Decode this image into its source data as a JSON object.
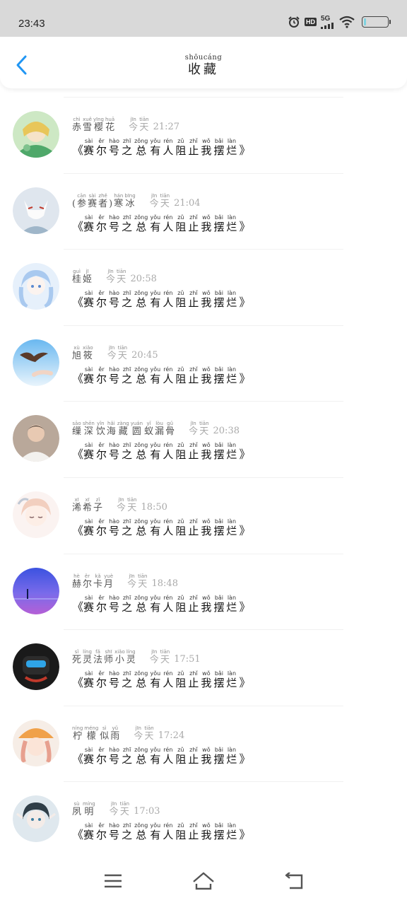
{
  "status_bar": {
    "time": "23:43",
    "icons": [
      "alarm-icon",
      "hd-icon",
      "5g-signal-icon",
      "wifi-icon",
      "battery-icon"
    ],
    "hd_label": "HD",
    "network_label": "5G",
    "battery_level": 0.1
  },
  "header": {
    "title": "收藏",
    "title_pinyin": "shōucáng",
    "back_icon": "chevron-left-icon"
  },
  "colors": {
    "accent": "#2196f3",
    "status_bar_bg": "#d9d9d9",
    "text_primary": "#222222",
    "text_muted": "#aaaaaa"
  },
  "items": [
    {
      "nickname": [
        [
          "赤",
          "chì"
        ],
        [
          "雪",
          "xuě"
        ],
        [
          "樱",
          "yīng"
        ],
        [
          "花",
          "huā"
        ]
      ],
      "day": [
        [
          "今",
          "jīn"
        ],
        [
          "天",
          "tiān"
        ]
      ],
      "time": "21:27",
      "title": [
        [
          "赛",
          "sài"
        ],
        [
          "尔",
          "ěr"
        ],
        [
          "号",
          "hào"
        ],
        [
          "之",
          "zhī"
        ],
        [
          "总",
          "zǒng"
        ],
        [
          "有",
          "yǒu"
        ],
        [
          "人",
          "rén"
        ],
        [
          "阻",
          "zǔ"
        ],
        [
          "止",
          "zhǐ"
        ],
        [
          "我",
          "wǒ"
        ],
        [
          "摆",
          "bǎi"
        ],
        [
          "烂",
          "làn"
        ]
      ],
      "avatar": "avatar-green-anime"
    },
    {
      "nickname": [
        [
          "(",
          ""
        ],
        [
          "参",
          "cān"
        ],
        [
          "赛",
          "sài"
        ],
        [
          "者",
          "zhě"
        ],
        [
          ")",
          ""
        ],
        [
          "寒",
          "hán"
        ],
        [
          "冰",
          "bīng"
        ]
      ],
      "day": [
        [
          "今",
          "jīn"
        ],
        [
          "天",
          "tiān"
        ]
      ],
      "time": "21:04",
      "title": [
        [
          "赛",
          "sài"
        ],
        [
          "尔",
          "ěr"
        ],
        [
          "号",
          "hào"
        ],
        [
          "之",
          "zhī"
        ],
        [
          "总",
          "zǒng"
        ],
        [
          "有",
          "yǒu"
        ],
        [
          "人",
          "rén"
        ],
        [
          "阻",
          "zǔ"
        ],
        [
          "止",
          "zhǐ"
        ],
        [
          "我",
          "wǒ"
        ],
        [
          "摆",
          "bǎi"
        ],
        [
          "烂",
          "làn"
        ]
      ],
      "avatar": "avatar-fox-mask"
    },
    {
      "nickname": [
        [
          "桂",
          "guì"
        ],
        [
          "姬",
          "jī"
        ]
      ],
      "day": [
        [
          "今",
          "jīn"
        ],
        [
          "天",
          "tiān"
        ]
      ],
      "time": "20:58",
      "title": [
        [
          "赛",
          "sài"
        ],
        [
          "尔",
          "ěr"
        ],
        [
          "号",
          "hào"
        ],
        [
          "之",
          "zhī"
        ],
        [
          "总",
          "zǒng"
        ],
        [
          "有",
          "yǒu"
        ],
        [
          "人",
          "rén"
        ],
        [
          "阻",
          "zǔ"
        ],
        [
          "止",
          "zhǐ"
        ],
        [
          "我",
          "wǒ"
        ],
        [
          "摆",
          "bǎi"
        ],
        [
          "烂",
          "làn"
        ]
      ],
      "avatar": "avatar-blue-girl"
    },
    {
      "nickname": [
        [
          "旭",
          "xù"
        ],
        [
          "筱",
          "xiǎo"
        ]
      ],
      "day": [
        [
          "今",
          "jīn"
        ],
        [
          "天",
          "tiān"
        ]
      ],
      "time": "20:45",
      "title": [
        [
          "赛",
          "sài"
        ],
        [
          "尔",
          "ěr"
        ],
        [
          "号",
          "hào"
        ],
        [
          "之",
          "zhī"
        ],
        [
          "总",
          "zǒng"
        ],
        [
          "有",
          "yǒu"
        ],
        [
          "人",
          "rén"
        ],
        [
          "阻",
          "zǔ"
        ],
        [
          "止",
          "zhǐ"
        ],
        [
          "我",
          "wǒ"
        ],
        [
          "摆",
          "bǎi"
        ],
        [
          "烂",
          "làn"
        ]
      ],
      "avatar": "avatar-bird-sky"
    },
    {
      "nickname": [
        [
          "缫",
          "sāo"
        ],
        [
          "深",
          "shēn"
        ],
        [
          "饮",
          "yǐn"
        ],
        [
          "海",
          "hǎi"
        ],
        [
          "藏",
          "zàng"
        ],
        [
          "圆",
          "yuán"
        ],
        [
          "蚁",
          "yǐ"
        ],
        [
          "漏",
          "lòu"
        ],
        [
          "骨",
          "gǔ"
        ]
      ],
      "day": [
        [
          "今",
          "jīn"
        ],
        [
          "天",
          "tiān"
        ]
      ],
      "time": "20:38",
      "title": [
        [
          "赛",
          "sài"
        ],
        [
          "尔",
          "ěr"
        ],
        [
          "号",
          "hào"
        ],
        [
          "之",
          "zhī"
        ],
        [
          "总",
          "zǒng"
        ],
        [
          "有",
          "yǒu"
        ],
        [
          "人",
          "rén"
        ],
        [
          "阻",
          "zǔ"
        ],
        [
          "止",
          "zhǐ"
        ],
        [
          "我",
          "wǒ"
        ],
        [
          "摆",
          "bǎi"
        ],
        [
          "烂",
          "làn"
        ]
      ],
      "avatar": "avatar-boy-photo"
    },
    {
      "nickname": [
        [
          "浠",
          "xī"
        ],
        [
          "希",
          "xī"
        ],
        [
          "子",
          "zǐ"
        ]
      ],
      "day": [
        [
          "今",
          "jīn"
        ],
        [
          "天",
          "tiān"
        ]
      ],
      "time": "18:50",
      "title": [
        [
          "赛",
          "sài"
        ],
        [
          "尔",
          "ěr"
        ],
        [
          "号",
          "hào"
        ],
        [
          "之",
          "zhī"
        ],
        [
          "总",
          "zǒng"
        ],
        [
          "有",
          "yǒu"
        ],
        [
          "人",
          "rén"
        ],
        [
          "阻",
          "zǔ"
        ],
        [
          "止",
          "zhǐ"
        ],
        [
          "我",
          "wǒ"
        ],
        [
          "摆",
          "bǎi"
        ],
        [
          "烂",
          "làn"
        ]
      ],
      "avatar": "avatar-pink-anime"
    },
    {
      "nickname": [
        [
          "赫",
          "hè"
        ],
        [
          "尔",
          "ěr"
        ],
        [
          "卡",
          "kǎ"
        ],
        [
          "月",
          "yuè"
        ]
      ],
      "day": [
        [
          "今",
          "jīn"
        ],
        [
          "天",
          "tiān"
        ]
      ],
      "time": "18:48",
      "title": [
        [
          "赛",
          "sài"
        ],
        [
          "尔",
          "ěr"
        ],
        [
          "号",
          "hào"
        ],
        [
          "之",
          "zhī"
        ],
        [
          "总",
          "zǒng"
        ],
        [
          "有",
          "yǒu"
        ],
        [
          "人",
          "rén"
        ],
        [
          "阻",
          "zǔ"
        ],
        [
          "止",
          "zhǐ"
        ],
        [
          "我",
          "wǒ"
        ],
        [
          "摆",
          "bǎi"
        ],
        [
          "烂",
          "làn"
        ]
      ],
      "avatar": "avatar-purple-sea"
    },
    {
      "nickname": [
        [
          "死",
          "sǐ"
        ],
        [
          "灵",
          "líng"
        ],
        [
          "法",
          "fǎ"
        ],
        [
          "师",
          "shī"
        ],
        [
          "小",
          "xiǎo"
        ],
        [
          "灵",
          "líng"
        ]
      ],
      "day": [
        [
          "今",
          "jīn"
        ],
        [
          "天",
          "tiān"
        ]
      ],
      "time": "17:51",
      "title": [
        [
          "赛",
          "sài"
        ],
        [
          "尔",
          "ěr"
        ],
        [
          "号",
          "hào"
        ],
        [
          "之",
          "zhī"
        ],
        [
          "总",
          "zǒng"
        ],
        [
          "有",
          "yǒu"
        ],
        [
          "人",
          "rén"
        ],
        [
          "阻",
          "zǔ"
        ],
        [
          "止",
          "zhǐ"
        ],
        [
          "我",
          "wǒ"
        ],
        [
          "摆",
          "bǎi"
        ],
        [
          "烂",
          "làn"
        ]
      ],
      "avatar": "avatar-dark-robot"
    },
    {
      "nickname": [
        [
          "柠",
          "níng"
        ],
        [
          "檬",
          "méng"
        ],
        [
          "似",
          "sì"
        ],
        [
          "雨",
          "yǔ"
        ]
      ],
      "day": [
        [
          "今",
          "jīn"
        ],
        [
          "天",
          "tiān"
        ]
      ],
      "time": "17:24",
      "title": [
        [
          "赛",
          "sài"
        ],
        [
          "尔",
          "ěr"
        ],
        [
          "号",
          "hào"
        ],
        [
          "之",
          "zhī"
        ],
        [
          "总",
          "zǒng"
        ],
        [
          "有",
          "yǒu"
        ],
        [
          "人",
          "rén"
        ],
        [
          "阻",
          "zǔ"
        ],
        [
          "止",
          "zhǐ"
        ],
        [
          "我",
          "wǒ"
        ],
        [
          "摆",
          "bǎi"
        ],
        [
          "烂",
          "làn"
        ]
      ],
      "avatar": "avatar-orange-hat"
    },
    {
      "nickname": [
        [
          "夙",
          "sù"
        ],
        [
          "明",
          "míng"
        ]
      ],
      "day": [
        [
          "今",
          "jīn"
        ],
        [
          "天",
          "tiān"
        ]
      ],
      "time": "17:03",
      "title": [
        [
          "赛",
          "sài"
        ],
        [
          "尔",
          "ěr"
        ],
        [
          "号",
          "hào"
        ],
        [
          "之",
          "zhī"
        ],
        [
          "总",
          "zǒng"
        ],
        [
          "有",
          "yǒu"
        ],
        [
          "人",
          "rén"
        ],
        [
          "阻",
          "zǔ"
        ],
        [
          "止",
          "zhǐ"
        ],
        [
          "我",
          "wǒ"
        ],
        [
          "摆",
          "bǎi"
        ],
        [
          "烂",
          "làn"
        ]
      ],
      "avatar": "avatar-elf-girl"
    }
  ],
  "book_open": "《",
  "book_close": "》",
  "bottom_nav": {
    "items": [
      "menu-icon",
      "home-icon",
      "back-icon"
    ]
  }
}
